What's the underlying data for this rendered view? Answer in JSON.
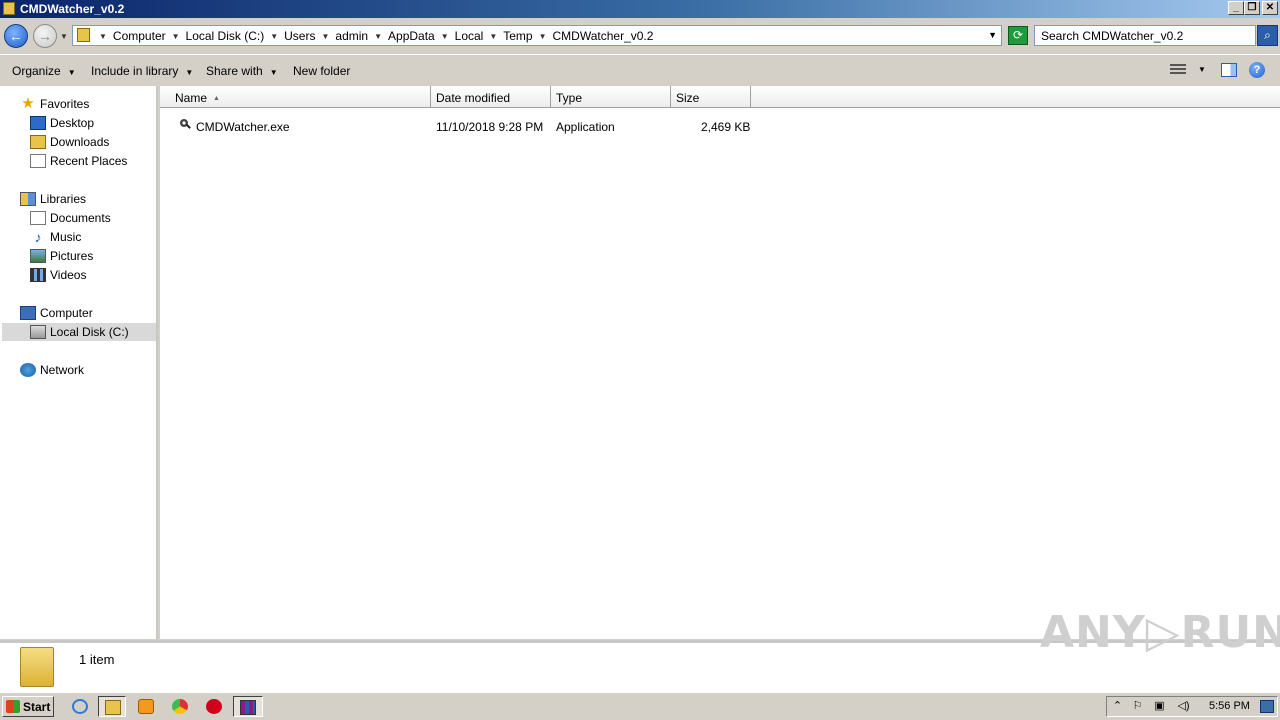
{
  "window": {
    "title": "CMDWatcher_v0.2",
    "minimize": "_",
    "restore": "❐",
    "close": "✕"
  },
  "address": {
    "breadcrumbs": [
      "Computer",
      "Local Disk (C:)",
      "Users",
      "admin",
      "AppData",
      "Local",
      "Temp",
      "CMDWatcher_v0.2"
    ],
    "search_placeholder": "Search CMDWatcher_v0.2"
  },
  "toolbar": {
    "organize": "Organize",
    "include_in_library": "Include in library",
    "share_with": "Share with",
    "new_folder": "New folder"
  },
  "nav": {
    "favorites": "Favorites",
    "desktop": "Desktop",
    "downloads": "Downloads",
    "recent_places": "Recent Places",
    "libraries": "Libraries",
    "documents": "Documents",
    "music": "Music",
    "pictures": "Pictures",
    "videos": "Videos",
    "computer": "Computer",
    "local_disk": "Local Disk (C:)",
    "network": "Network"
  },
  "columns": {
    "name": "Name",
    "date_modified": "Date modified",
    "type": "Type",
    "size": "Size"
  },
  "files": [
    {
      "name": "CMDWatcher.exe",
      "date_modified": "11/10/2018 9:28 PM",
      "type": "Application",
      "size": "2,469 KB"
    }
  ],
  "details": {
    "item_count": "1 item"
  },
  "watermark": "ANY▷RUN",
  "taskbar": {
    "start": "Start",
    "clock": "5:56 PM"
  },
  "colors": {
    "title_bar": "#0a246a",
    "chrome": "#d4d0c8",
    "selection": "#d9d9d9"
  }
}
